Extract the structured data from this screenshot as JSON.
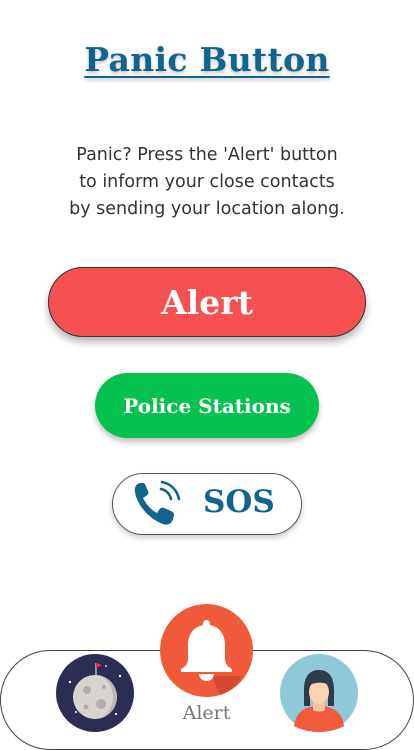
{
  "header": {
    "title": "Panic Button"
  },
  "description": {
    "line1": "Panic? Press the 'Alert' button",
    "line2": "to inform your close contacts",
    "line3": "by sending your location along."
  },
  "buttons": {
    "alert_label": "Alert",
    "police_label": "Police Stations",
    "sos_label": "SOS"
  },
  "bottom_nav": {
    "items": [
      {
        "name": "moon-icon",
        "label": ""
      },
      {
        "name": "bell-icon",
        "label": "Alert"
      },
      {
        "name": "profile-icon",
        "label": ""
      }
    ]
  },
  "colors": {
    "title": "#13638f",
    "alert": "#f65050",
    "police": "#04c24d",
    "sos_text": "#13638f",
    "bell_circle": "#f05a3a"
  }
}
